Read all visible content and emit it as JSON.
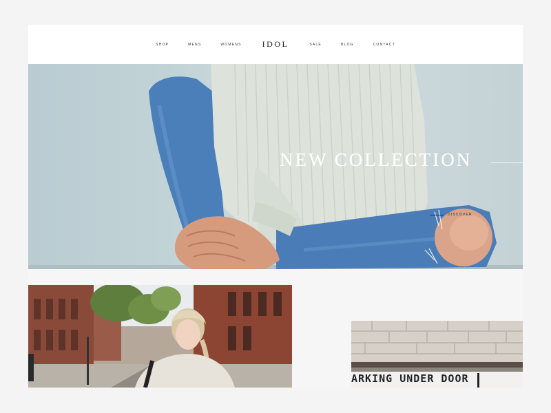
{
  "nav": {
    "left_items": [
      {
        "label": "SHOP"
      },
      {
        "label": "MENS"
      },
      {
        "label": "WOMENS"
      }
    ],
    "logo": "IDOL",
    "right_items": [
      {
        "label": "SALE"
      },
      {
        "label": "BLOG"
      },
      {
        "label": "CONTACT"
      }
    ]
  },
  "hero": {
    "title": "NEW COLLECTION",
    "cta_label": "DISCOVER"
  },
  "feature_right": {
    "sign_text": "ARKING UNDER DOOR"
  },
  "colors": {
    "hero_bg": "#c6d6da",
    "sweater": "#dfe4dc",
    "denim": "#4f83bc",
    "brick": "#8a4a3a"
  }
}
